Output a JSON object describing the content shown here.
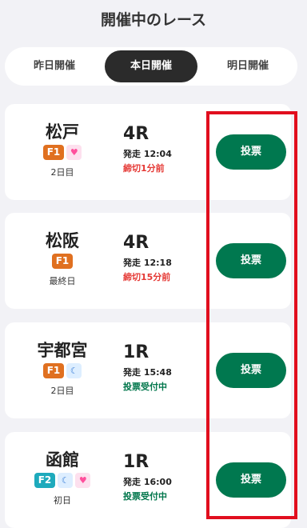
{
  "header": {
    "title": "開催中のレース"
  },
  "tabs": [
    {
      "label": "昨日開催"
    },
    {
      "label": "本日開催"
    },
    {
      "label": "明日開催"
    }
  ],
  "races": [
    {
      "venue": "松戸",
      "grade": "F1",
      "icons": [
        "heart-icon"
      ],
      "day": "2日目",
      "race": "4R",
      "start": "発走 12:04",
      "status": "締切1分前",
      "status_color": "#e53935",
      "button": "投票"
    },
    {
      "venue": "松阪",
      "grade": "F1",
      "icons": [],
      "day": "最終日",
      "race": "4R",
      "start": "発走 12:18",
      "status": "締切15分前",
      "status_color": "#e53935",
      "button": "投票"
    },
    {
      "venue": "宇都宮",
      "grade": "F1",
      "icons": [
        "moon-icon"
      ],
      "day": "2日目",
      "race": "1R",
      "start": "発走 15:48",
      "status": "投票受付中",
      "status_color": "#00764b",
      "button": "投票"
    },
    {
      "venue": "函館",
      "grade": "F2",
      "icons": [
        "moon-icon",
        "heart-icon"
      ],
      "day": "初日",
      "race": "1R",
      "start": "発走 16:00",
      "status": "投票受付中",
      "status_color": "#00764b",
      "button": "投票"
    }
  ],
  "colors": {
    "accent": "#00784f",
    "highlight": "#e10e1e",
    "grade_f1": "#e07020",
    "grade_f2": "#1eaabc"
  }
}
